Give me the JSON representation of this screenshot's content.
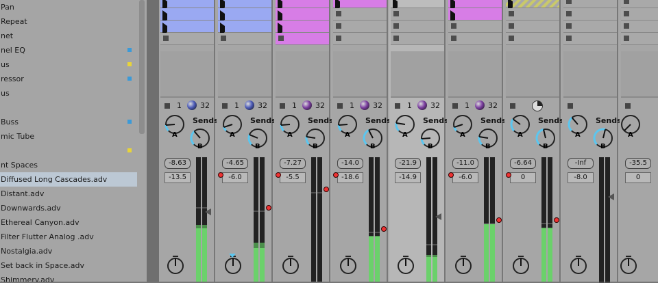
{
  "browser": {
    "items": [
      {
        "label": "Pan",
        "dot": null
      },
      {
        "label": "Repeat",
        "dot": null
      },
      {
        "label": "net",
        "dot": null
      },
      {
        "label": "nel EQ",
        "dot": "#3b9ad8"
      },
      {
        "label": "us",
        "dot": "#e8d438"
      },
      {
        "label": "ressor",
        "dot": "#3b9ad8"
      },
      {
        "label": "us",
        "dot": null
      },
      {
        "label": "",
        "dot": null
      },
      {
        "label": " Buss",
        "dot": "#3b9ad8"
      },
      {
        "label": "mic Tube",
        "dot": null
      },
      {
        "label": "",
        "dot": "#e8d438"
      },
      {
        "label": "nt Spaces",
        "dot": null
      },
      {
        "label": "Diffused Long Cascades.adv",
        "dot": null,
        "selected": true
      },
      {
        "label": "Distant.adv",
        "dot": null
      },
      {
        "label": "Downwards.adv",
        "dot": null
      },
      {
        "label": "Ethereal Canyon.adv",
        "dot": null
      },
      {
        "label": "Filter Flutter Analog .adv",
        "dot": null
      },
      {
        "label": "Nostalgia.adv",
        "dot": null
      },
      {
        "label": "Set back in Space.adv",
        "dot": null
      },
      {
        "label": "Shimmery.adv",
        "dot": null
      }
    ]
  },
  "colors": {
    "blue_clip": "#9aa9f2",
    "pink_clip": "#d77de6",
    "meter_green": "#6bd16b",
    "send_arc": "#5bc6ef"
  },
  "tracks": [
    {
      "clip_color": "#9aa9f2",
      "clips": [
        2,
        2,
        2,
        0
      ],
      "input": "1",
      "output": "32",
      "ball": "#4c5bb8",
      "vol": "-8.63",
      "peak": "-13.5",
      "level": 0.43,
      "hold": 0.6,
      "send_a": 0.15,
      "send_b": 0.35,
      "arm": false,
      "pan_arrow": false
    },
    {
      "clip_color": "#9aa9f2",
      "clips": [
        2,
        2,
        2,
        0
      ],
      "input": "1",
      "output": "32",
      "ball": "#4c5bb8",
      "vol": "-4.65",
      "peak": "-6.0",
      "level": 0.27,
      "hold": 0.57,
      "send_a": 0.1,
      "send_b": 0.25,
      "arm": true,
      "pan_arrow": true
    },
    {
      "clip_color": "#d77de6",
      "clips": [
        2,
        2,
        2,
        1
      ],
      "input": "1",
      "output": "32",
      "ball": "#7b3ea0",
      "vol": "-7.27",
      "peak": "-5.5",
      "level": 0.0,
      "hold": 0.72,
      "send_a": 0.15,
      "send_b": 0.2,
      "arm": true,
      "pan_arrow": false
    },
    {
      "clip_color": "#d77de6",
      "clips": [
        2,
        0,
        0,
        0
      ],
      "input": "1",
      "output": "32",
      "ball": "#7b3ea0",
      "vol": "-14.0",
      "peak": "-18.6",
      "level": 0.36,
      "hold": 0.4,
      "send_a": 0.15,
      "send_b": 0.4,
      "arm": true,
      "pan_arrow": false
    },
    {
      "clip_color": "#bdbdbd",
      "clips": [
        2,
        0,
        0,
        0
      ],
      "input": "1",
      "output": "32",
      "ball": "#7b3ea0",
      "vol": "-21.9",
      "peak": "-14.9",
      "level": 0.2,
      "hold": 0.3,
      "send_a": 0.2,
      "send_b": 0.15,
      "arm": false,
      "pan_arrow": false
    },
    {
      "clip_color": "#d77de6",
      "clips": [
        2,
        2,
        0,
        0
      ],
      "input": "1",
      "output": "32",
      "ball": "#7b3ea0",
      "vol": "-11.0",
      "peak": "-6.0",
      "level": 0.47,
      "hold": 0.47,
      "send_a": 0.1,
      "send_b": 0.2,
      "arm": true,
      "pan_arrow": false
    },
    {
      "clip_color": "#c9c96a",
      "clips": [
        3,
        0,
        0,
        0
      ],
      "input": "",
      "output": "",
      "ball": "",
      "vol": "-6.64",
      "peak": "0",
      "level": 0.43,
      "hold": 0.47,
      "send_a": 0.3,
      "send_b": 0.45,
      "arm": true,
      "pan_arrow": false
    },
    {
      "clip_color": "#bdbdbd",
      "clips": [
        0,
        0,
        0,
        0
      ],
      "input": "",
      "output": "",
      "ball": "",
      "vol": "-Inf",
      "peak": "-8.0",
      "level": 0.0,
      "hold": 0.0,
      "send_a": 0.35,
      "send_b": 0.55,
      "arm": false,
      "pan_arrow": false
    },
    {
      "clip_color": "#bdbdbd",
      "clips": [
        0,
        0,
        0,
        0
      ],
      "input": "",
      "output": "",
      "ball": "",
      "vol": "-35.5",
      "peak": "0",
      "level": 0.0,
      "hold": 0.0,
      "send_a": 0.0,
      "send_b": 0.0,
      "arm": false,
      "pan_arrow": false
    }
  ],
  "labels": {
    "sends": "Sends",
    "knob_a": "A",
    "knob_b": "B"
  }
}
